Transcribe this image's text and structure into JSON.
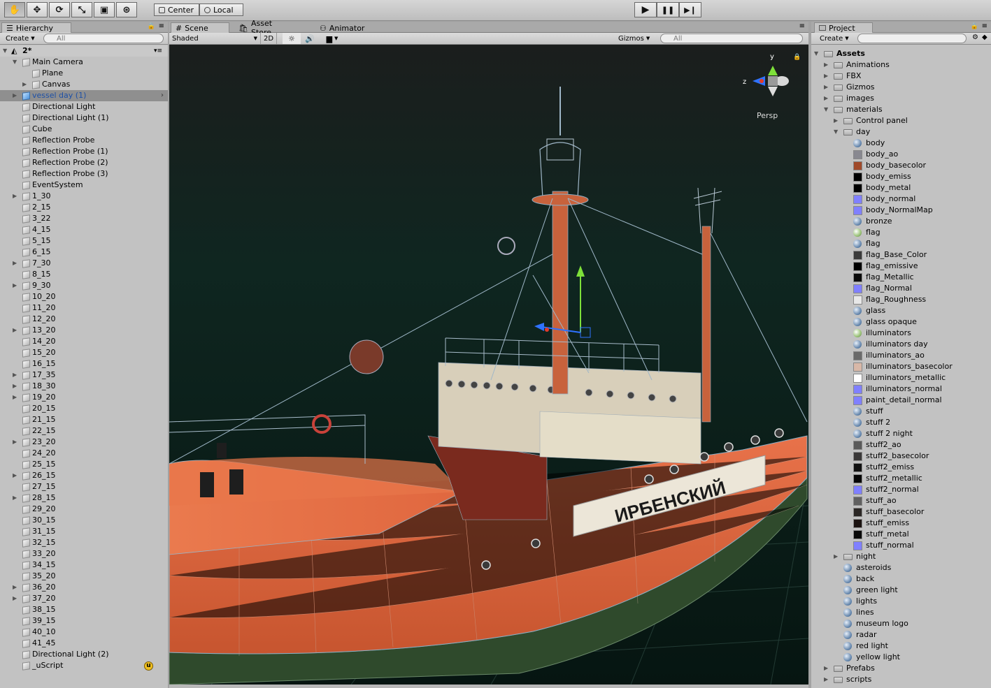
{
  "toolbar": {
    "tools": [
      {
        "name": "hand-tool-icon",
        "glyph": "✋"
      },
      {
        "name": "move-tool-icon",
        "glyph": "✥"
      },
      {
        "name": "rotate-tool-icon",
        "glyph": "⟳"
      },
      {
        "name": "scale-tool-icon",
        "glyph": "⤡"
      },
      {
        "name": "rect-tool-icon",
        "glyph": "▣"
      },
      {
        "name": "transform-tool-icon",
        "glyph": "⊛"
      }
    ],
    "pivot_label": "Center",
    "space_label": "Local",
    "play_glyph": "▶",
    "pause_glyph": "❚❚",
    "step_glyph": "▶❙"
  },
  "hierarchy": {
    "tab_label": "Hierarchy",
    "create_label": "Create",
    "search_placeholder": "All",
    "scene_name": "2*",
    "items": [
      {
        "label": "Main Camera",
        "indent": 1,
        "arrow": "down"
      },
      {
        "label": "Plane",
        "indent": 2
      },
      {
        "label": "Canvas",
        "indent": 2,
        "arrow": "right"
      },
      {
        "label": "vessel day (1)",
        "indent": 1,
        "arrow": "right",
        "selected": true,
        "prefab": true
      },
      {
        "label": "Directional Light",
        "indent": 1
      },
      {
        "label": "Directional Light (1)",
        "indent": 1
      },
      {
        "label": "Cube",
        "indent": 1
      },
      {
        "label": "Reflection Probe",
        "indent": 1
      },
      {
        "label": "Reflection Probe (1)",
        "indent": 1
      },
      {
        "label": "Reflection Probe (2)",
        "indent": 1
      },
      {
        "label": "Reflection Probe (3)",
        "indent": 1
      },
      {
        "label": "EventSystem",
        "indent": 1
      },
      {
        "label": "1_30",
        "indent": 1,
        "arrow": "right"
      },
      {
        "label": "2_15",
        "indent": 1
      },
      {
        "label": "3_22",
        "indent": 1
      },
      {
        "label": "4_15",
        "indent": 1
      },
      {
        "label": "5_15",
        "indent": 1
      },
      {
        "label": "6_15",
        "indent": 1
      },
      {
        "label": "7_30",
        "indent": 1,
        "arrow": "right"
      },
      {
        "label": "8_15",
        "indent": 1
      },
      {
        "label": "9_30",
        "indent": 1,
        "arrow": "right"
      },
      {
        "label": "10_20",
        "indent": 1
      },
      {
        "label": "11_20",
        "indent": 1
      },
      {
        "label": "12_20",
        "indent": 1
      },
      {
        "label": "13_20",
        "indent": 1,
        "arrow": "right"
      },
      {
        "label": "14_20",
        "indent": 1
      },
      {
        "label": "15_20",
        "indent": 1
      },
      {
        "label": "16_15",
        "indent": 1
      },
      {
        "label": "17_35",
        "indent": 1,
        "arrow": "right"
      },
      {
        "label": "18_30",
        "indent": 1,
        "arrow": "right"
      },
      {
        "label": "19_20",
        "indent": 1,
        "arrow": "right"
      },
      {
        "label": "20_15",
        "indent": 1
      },
      {
        "label": "21_15",
        "indent": 1
      },
      {
        "label": "22_15",
        "indent": 1
      },
      {
        "label": "23_20",
        "indent": 1,
        "arrow": "right"
      },
      {
        "label": "24_20",
        "indent": 1
      },
      {
        "label": "25_15",
        "indent": 1
      },
      {
        "label": "26_15",
        "indent": 1,
        "arrow": "right"
      },
      {
        "label": "27_15",
        "indent": 1
      },
      {
        "label": "28_15",
        "indent": 1,
        "arrow": "right"
      },
      {
        "label": "29_20",
        "indent": 1
      },
      {
        "label": "30_15",
        "indent": 1
      },
      {
        "label": "31_15",
        "indent": 1
      },
      {
        "label": "32_15",
        "indent": 1
      },
      {
        "label": "33_20",
        "indent": 1
      },
      {
        "label": "34_15",
        "indent": 1
      },
      {
        "label": "35_20",
        "indent": 1
      },
      {
        "label": "36_20",
        "indent": 1,
        "arrow": "right"
      },
      {
        "label": "37_20",
        "indent": 1,
        "arrow": "right"
      },
      {
        "label": "38_15",
        "indent": 1
      },
      {
        "label": "39_15",
        "indent": 1
      },
      {
        "label": "40_10",
        "indent": 1
      },
      {
        "label": "41_45",
        "indent": 1
      },
      {
        "label": "Directional Light (2)",
        "indent": 1
      },
      {
        "label": "_uScript",
        "indent": 1,
        "badge": true
      }
    ]
  },
  "tabs": {
    "scene": "Scene",
    "asset_store": "Asset Store",
    "animator": "Animator"
  },
  "scene_toolbar": {
    "shading_mode": "Shaded",
    "mode_2d": "2D",
    "gizmos_label": "Gizmos",
    "search_placeholder": "All"
  },
  "scene_view": {
    "gizmo_y": "y",
    "gizmo_z": "z",
    "projection_label": "Persp",
    "ship_name": "ИРБЕНСКИЙ"
  },
  "project": {
    "tab_label": "Project",
    "create_label": "Create",
    "search_placeholder": "",
    "items": [
      {
        "label": "Assets",
        "indent": 0,
        "arrow": "down",
        "type": "folder",
        "bold": true
      },
      {
        "label": "Animations",
        "indent": 1,
        "arrow": "right",
        "type": "folder"
      },
      {
        "label": "FBX",
        "indent": 1,
        "arrow": "right",
        "type": "folder"
      },
      {
        "label": "Gizmos",
        "indent": 1,
        "arrow": "right",
        "type": "folder"
      },
      {
        "label": "images",
        "indent": 1,
        "arrow": "right",
        "type": "folder"
      },
      {
        "label": "materials",
        "indent": 1,
        "arrow": "down",
        "type": "folder"
      },
      {
        "label": "Control panel",
        "indent": 2,
        "arrow": "right",
        "type": "folder"
      },
      {
        "label": "day",
        "indent": 2,
        "arrow": "down",
        "type": "folder"
      },
      {
        "label": "body",
        "indent": 3,
        "type": "material"
      },
      {
        "label": "body_ao",
        "indent": 3,
        "type": "texture",
        "color": "#888890"
      },
      {
        "label": "body_basecolor",
        "indent": 3,
        "type": "texture",
        "color": "#a04a2a"
      },
      {
        "label": "body_emiss",
        "indent": 3,
        "type": "texture",
        "color": "#000000"
      },
      {
        "label": "body_metal",
        "indent": 3,
        "type": "texture",
        "color": "#000000"
      },
      {
        "label": "body_normal",
        "indent": 3,
        "type": "texture",
        "color": "#8080ff"
      },
      {
        "label": "body_NormalMap",
        "indent": 3,
        "type": "texture",
        "color": "#8080ff"
      },
      {
        "label": "bronze",
        "indent": 3,
        "type": "material"
      },
      {
        "label": "flag",
        "indent": 3,
        "type": "shader"
      },
      {
        "label": "flag",
        "indent": 3,
        "type": "material"
      },
      {
        "label": "flag_Base_Color",
        "indent": 3,
        "type": "texture",
        "color": "#3a3a3a"
      },
      {
        "label": "flag_emissive",
        "indent": 3,
        "type": "texture",
        "color": "#000000"
      },
      {
        "label": "flag_Metallic",
        "indent": 3,
        "type": "texture",
        "color": "#0a0a0a"
      },
      {
        "label": "flag_Normal",
        "indent": 3,
        "type": "texture",
        "color": "#8080ff"
      },
      {
        "label": "flag_Roughness",
        "indent": 3,
        "type": "texture",
        "color": "#e8e8e8"
      },
      {
        "label": "glass",
        "indent": 3,
        "type": "material"
      },
      {
        "label": "glass opaque",
        "indent": 3,
        "type": "material"
      },
      {
        "label": "illuminators",
        "indent": 3,
        "type": "shader"
      },
      {
        "label": "illuminators day",
        "indent": 3,
        "type": "material"
      },
      {
        "label": "illuminators_ao",
        "indent": 3,
        "type": "texture",
        "color": "#6a6a6a"
      },
      {
        "label": "illuminators_basecolor",
        "indent": 3,
        "type": "texture",
        "color": "#d8b8a8"
      },
      {
        "label": "illuminators_metallic",
        "indent": 3,
        "type": "texture",
        "color": "#ffffff"
      },
      {
        "label": "illuminators_normal",
        "indent": 3,
        "type": "texture",
        "color": "#8080ff"
      },
      {
        "label": "paint_detail_normal",
        "indent": 3,
        "type": "texture",
        "color": "#8080ff"
      },
      {
        "label": "stuff",
        "indent": 3,
        "type": "material"
      },
      {
        "label": "stuff 2",
        "indent": 3,
        "type": "material"
      },
      {
        "label": "stuff 2 night",
        "indent": 3,
        "type": "material"
      },
      {
        "label": "stuff2_ao",
        "indent": 3,
        "type": "texture",
        "color": "#5a5a5a"
      },
      {
        "label": "stuff2_basecolor",
        "indent": 3,
        "type": "texture",
        "color": "#3a3838"
      },
      {
        "label": "stuff2_emiss",
        "indent": 3,
        "type": "texture",
        "color": "#101010"
      },
      {
        "label": "stuff2_metallic",
        "indent": 3,
        "type": "texture",
        "color": "#050505"
      },
      {
        "label": "stuff2_normal",
        "indent": 3,
        "type": "texture",
        "color": "#8080ff"
      },
      {
        "label": "stuff_ao",
        "indent": 3,
        "type": "texture",
        "color": "#606060"
      },
      {
        "label": "stuff_basecolor",
        "indent": 3,
        "type": "texture",
        "color": "#2a2624"
      },
      {
        "label": "stuff_emiss",
        "indent": 3,
        "type": "texture",
        "color": "#1a1210"
      },
      {
        "label": "stuff_metal",
        "indent": 3,
        "type": "texture",
        "color": "#080808"
      },
      {
        "label": "stuff_normal",
        "indent": 3,
        "type": "texture",
        "color": "#8080ff"
      },
      {
        "label": "night",
        "indent": 2,
        "arrow": "right",
        "type": "folder"
      },
      {
        "label": "asteroids",
        "indent": 2,
        "type": "material"
      },
      {
        "label": "back",
        "indent": 2,
        "type": "material"
      },
      {
        "label": "green light",
        "indent": 2,
        "type": "material"
      },
      {
        "label": "lights",
        "indent": 2,
        "type": "material"
      },
      {
        "label": "lines",
        "indent": 2,
        "type": "material"
      },
      {
        "label": "museum logo",
        "indent": 2,
        "type": "material"
      },
      {
        "label": "radar",
        "indent": 2,
        "type": "material"
      },
      {
        "label": "red light",
        "indent": 2,
        "type": "material"
      },
      {
        "label": "yellow light",
        "indent": 2,
        "type": "material"
      },
      {
        "label": "Prefabs",
        "indent": 1,
        "arrow": "right",
        "type": "folder"
      },
      {
        "label": "scripts",
        "indent": 1,
        "arrow": "right",
        "type": "folder"
      }
    ]
  },
  "colors": {
    "hull_orange": "#e2683c",
    "selection_text": "#1d50a6",
    "scene_bg_top": "#1a1f1d",
    "scene_bg_bottom": "#061a15"
  }
}
